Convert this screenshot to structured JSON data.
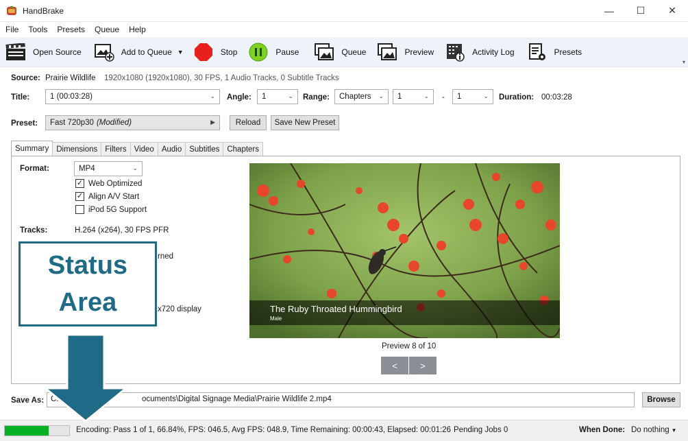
{
  "window": {
    "title": "HandBrake",
    "minimize": "—",
    "maximize": "☐",
    "close": "✕"
  },
  "menu": [
    "File",
    "Tools",
    "Presets",
    "Queue",
    "Help"
  ],
  "toolbar": {
    "open_source": "Open Source",
    "add_to_queue": "Add to Queue",
    "stop": "Stop",
    "pause": "Pause",
    "queue": "Queue",
    "preview": "Preview",
    "activity_log": "Activity Log",
    "presets": "Presets"
  },
  "source": {
    "label": "Source:",
    "name": "Prairie Wildlife",
    "info": "1920x1080 (1920x1080), 30 FPS, 1 Audio Tracks, 0 Subtitle Tracks"
  },
  "title_row": {
    "title_label": "Title:",
    "title_value": "1  (00:03:28)",
    "angle_label": "Angle:",
    "angle_value": "1",
    "range_label": "Range:",
    "range_mode": "Chapters",
    "range_start": "1",
    "range_dash": "-",
    "range_end": "1",
    "duration_label": "Duration:",
    "duration_value": "00:03:28"
  },
  "preset": {
    "label": "Preset:",
    "name": "Fast 720p30",
    "modified": "(Modified)",
    "reload": "Reload",
    "save_new": "Save New Preset"
  },
  "tabs": [
    "Summary",
    "Dimensions",
    "Filters",
    "Video",
    "Audio",
    "Subtitles",
    "Chapters"
  ],
  "summary": {
    "format_label": "Format:",
    "format_value": "MP4",
    "web_optimized": "Web Optimized",
    "web_optimized_checked": true,
    "align_av": "Align A/V Start",
    "align_av_checked": true,
    "ipod": "iPod 5G Support",
    "ipod_checked": false,
    "tracks_label": "Tracks:",
    "tracks_video": "H.264 (x264), 30 FPS PFR",
    "tracks_partial_2": "rned",
    "display_partial": "x720 display"
  },
  "preview": {
    "caption_title": "The Ruby Throated Hummingbird",
    "caption_sub": "Male",
    "counter": "Preview 8 of 10",
    "prev": "<",
    "next": ">"
  },
  "save_as": {
    "label": "Save As:",
    "path_start": "C:\\U",
    "path_end": "ocuments\\Digital Signage Media\\Prairie Wildlife 2.mp4",
    "browse": "Browse"
  },
  "status": {
    "progress_percent": 68,
    "encoding_text": "Encoding: Pass 1 of 1,  66.84%, FPS: 046.5,  Avg FPS: 048.9,  Time Remaining: 00:00:43,  Elapsed: 00:01:26",
    "pending": "Pending Jobs 0",
    "when_done_label": "When Done:",
    "when_done_value": "Do nothing"
  },
  "callout": {
    "line1": "Status",
    "line2": "Area",
    "color": "#1f6a87"
  }
}
